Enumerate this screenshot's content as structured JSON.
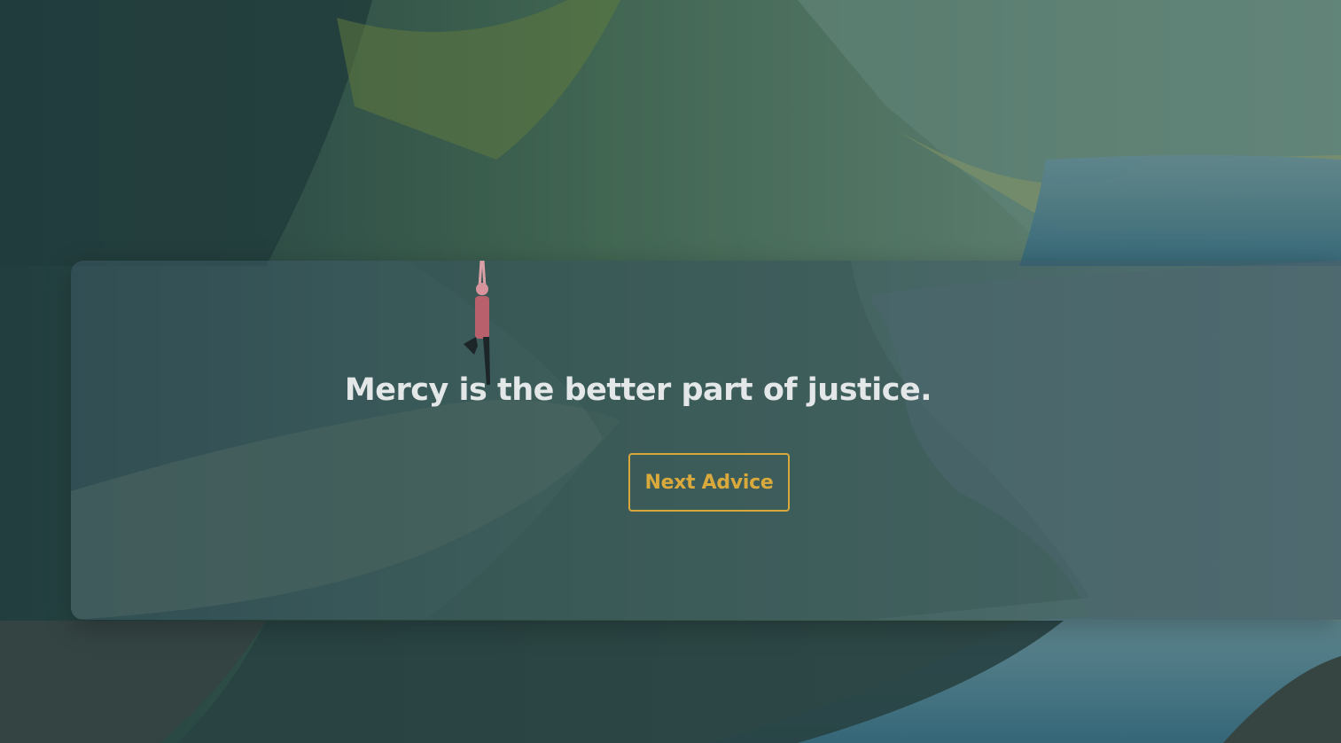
{
  "advice": {
    "text": "Mercy is the better part of justice."
  },
  "actions": {
    "next_label": "Next Advice"
  },
  "colors": {
    "accent": "#d7a93b",
    "text": "#e4e7e8",
    "card": "#3c5a64"
  }
}
